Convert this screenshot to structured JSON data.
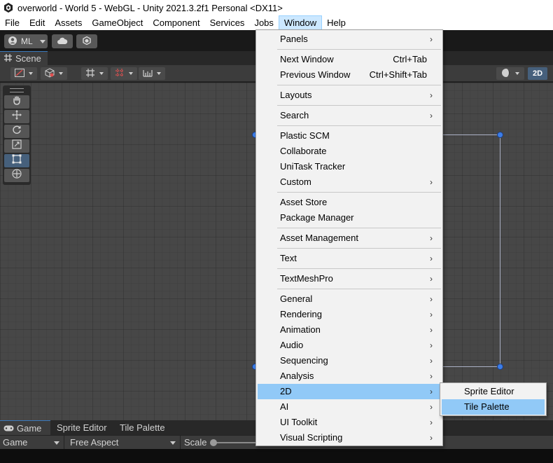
{
  "window": {
    "title": "overworld - World 5 - WebGL - Unity 2021.3.2f1 Personal <DX11>",
    "app_icon": "unity-logo-icon"
  },
  "menubar": {
    "items": [
      "File",
      "Edit",
      "Assets",
      "GameObject",
      "Component",
      "Services",
      "Jobs",
      "Window",
      "Help"
    ],
    "active": "Window"
  },
  "toolbar": {
    "account_label": "ML",
    "account_icon": "user-icon",
    "cloud_icon": "cloud-icon",
    "collab_icon": "collab-icon"
  },
  "scene": {
    "tab_label": "Scene",
    "tab_icon": "grid-icon",
    "mode_2d_label": "2D",
    "tools": [
      "hand-icon",
      "move-icon",
      "rotate-icon",
      "scale-icon",
      "rect-tool-icon",
      "transform-icon"
    ],
    "selected_tool": "rect-tool-icon"
  },
  "window_menu": {
    "items": [
      {
        "label": "Panels",
        "submenu": true
      },
      {
        "label": "Next Window",
        "shortcut": "Ctrl+Tab"
      },
      {
        "label": "Previous Window",
        "shortcut": "Ctrl+Shift+Tab"
      },
      {
        "label": "Layouts",
        "submenu": true
      },
      {
        "label": "Search",
        "submenu": true
      },
      {
        "label": "Plastic SCM"
      },
      {
        "label": "Collaborate"
      },
      {
        "label": "UniTask Tracker"
      },
      {
        "label": "Custom",
        "submenu": true
      },
      {
        "label": "Asset Store"
      },
      {
        "label": "Package Manager"
      },
      {
        "label": "Asset Management",
        "submenu": true
      },
      {
        "label": "Text",
        "submenu": true
      },
      {
        "label": "TextMeshPro",
        "submenu": true
      },
      {
        "label": "General",
        "submenu": true
      },
      {
        "label": "Rendering",
        "submenu": true
      },
      {
        "label": "Animation",
        "submenu": true
      },
      {
        "label": "Audio",
        "submenu": true
      },
      {
        "label": "Sequencing",
        "submenu": true
      },
      {
        "label": "Analysis",
        "submenu": true
      },
      {
        "label": "2D",
        "submenu": true,
        "highlighted": true
      },
      {
        "label": "AI",
        "submenu": true
      },
      {
        "label": "UI Toolkit",
        "submenu": true
      },
      {
        "label": "Visual Scripting",
        "submenu": true
      }
    ]
  },
  "submenu_2d": {
    "items": [
      {
        "label": "Sprite Editor"
      },
      {
        "label": "Tile Palette",
        "highlighted": true
      }
    ]
  },
  "game_panel": {
    "tabs": [
      "Game",
      "Sprite Editor",
      "Tile Palette"
    ],
    "active_tab": "Game",
    "display_select": "Game",
    "aspect_select": "Free Aspect",
    "scale_label": "Scale"
  },
  "colors": {
    "menu_highlight": "#91c9f7",
    "selection_blue": "#46607c",
    "handle_blue": "#3b7de8"
  }
}
